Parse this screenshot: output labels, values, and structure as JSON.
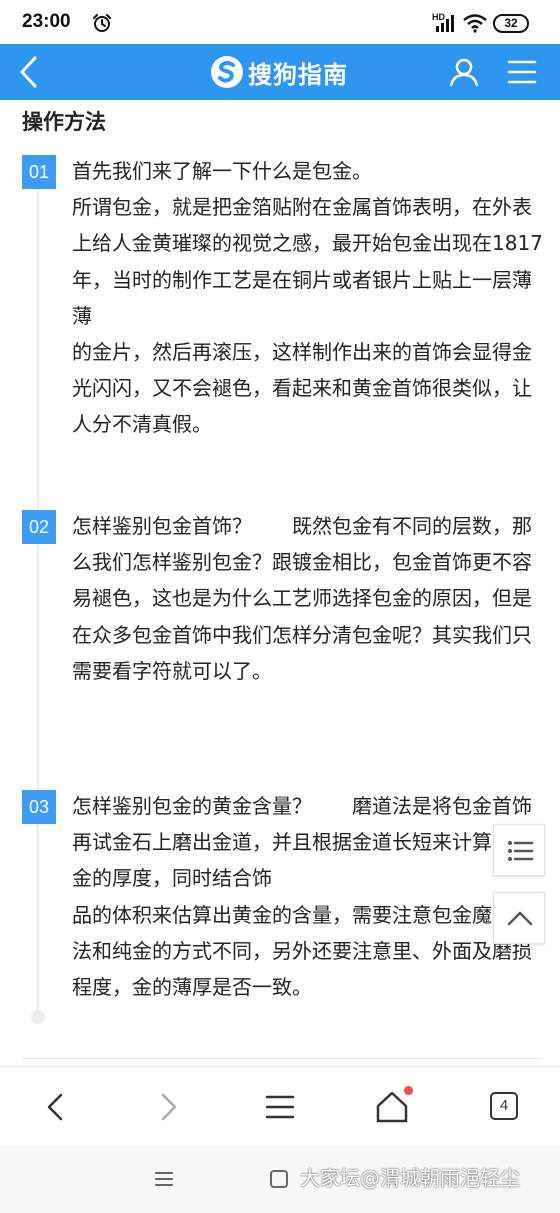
{
  "status_bar": {
    "time": "23:00",
    "network": "HD",
    "battery": "32"
  },
  "header": {
    "logo_text": "搜狗指南"
  },
  "section_title": "操作方法",
  "steps": [
    {
      "number": "01",
      "text": "首先我们来了解一下什么是包金。\n所谓包金，就是把金箔贴附在金属首饰表明，在外表上给人金黄璀璨的视觉之感，最开始包金出现在1817年，当时的制作工艺是在铜片或者银片上贴上一层薄薄\n的金片，然后再滚压，这样制作出来的首饰会显得金光闪闪，又不会褪色，看起来和黄金首饰很类似，让人分不清真假。"
    },
    {
      "number": "02",
      "text": "怎样鉴别包金首饰？　　既然包金有不同的层数，那么我们怎样鉴别包金？跟镀金相比，包金首饰更不容易褪色，这也是为什么工艺师选择包金的原因，但是在众多包金首饰中我们怎样分清包金呢？其实我们只需要看字符就可以了。"
    },
    {
      "number": "03",
      "text": "怎样鉴别包金的黄金含量？　　磨道法是将包金首饰再试金石上磨出金道，并且根据金道长短来计算出包金的厚度，同时结合饰\n品的体积来估算出黄金的含量，需要注意包金魔道方法和纯金的方式不同，另外还要注意里、外面及磨损程度，金的薄厚是否一致。"
    }
  ],
  "toolbar": {
    "tab_count": "4"
  },
  "watermark": "大家坛@渭城朝雨浥轻尘",
  "icons": {
    "back": "chevron-left-icon",
    "user": "user-icon",
    "menu": "hamburger-icon",
    "toc": "list-icon",
    "top": "chevron-up-icon",
    "home": "home-icon",
    "tabs": "tabs-icon"
  },
  "colors": {
    "header": "#2e96ee",
    "badge": "#3f9cf5",
    "notification": "#f24b4b"
  }
}
